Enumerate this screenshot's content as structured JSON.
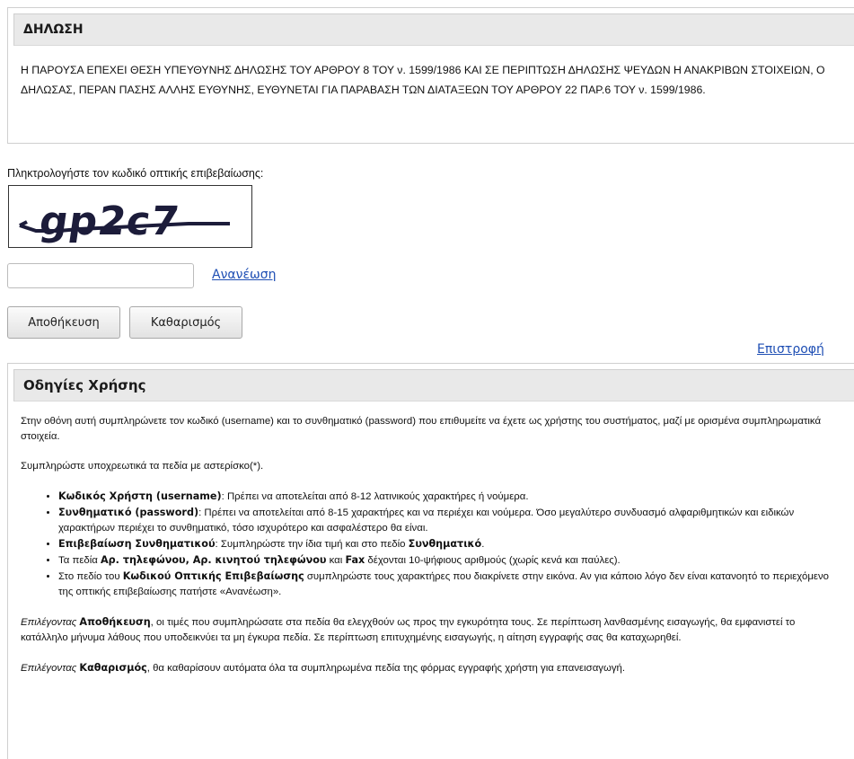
{
  "declaration": {
    "title": "ΔΗΛΩΣΗ",
    "text": "Η ΠΑΡΟΥΣΑ ΕΠΕΧΕΙ ΘΕΣΗ ΥΠΕΥΘΥΝΗΣ ΔΗΛΩΣΗΣ ΤΟΥ ΑΡΘΡΟΥ 8 ΤΟΥ ν. 1599/1986 ΚΑΙ ΣΕ ΠΕΡΙΠΤΩΣΗ ΔΗΛΩΣΗΣ ΨΕΥΔΩΝ Η ΑΝΑΚΡΙΒΩΝ ΣΤΟΙΧΕΙΩΝ, Ο ΔΗΛΩΣΑΣ, ΠΕΡΑΝ ΠΑΣΗΣ ΑΛΛΗΣ ΕΥΘΥΝΗΣ, ΕΥΘΥΝΕΤΑΙ ΓΙΑ ΠΑΡΑΒΑΣΗ ΤΩΝ ΔΙΑΤΑΞΕΩΝ ΤΟΥ ΑΡΘΡΟΥ 22 ΠΑΡ.6 ΤΟΥ ν. 1599/1986."
  },
  "captcha": {
    "label": "Πληκτρολογήστε τον κωδικό οπτικής επιβεβαίωσης:",
    "image_text": "gp2c7",
    "input_value": "",
    "refresh_label": "Ανανέωση"
  },
  "buttons": {
    "save": "Αποθήκευση",
    "clear": "Καθαρισμός"
  },
  "return_link": "Επιστροφή",
  "instructions": {
    "title": "Οδηγίες Χρήσης",
    "intro": "Στην οθόνη αυτή συμπληρώνετε τον κωδικό (username) και το συνθηματικό (password) που επιθυμείτε να έχετε ως χρήστης του συστήματος, μαζί με ορισμένα συμπληρωματικά στοιχεία.",
    "required": "Συμπληρώστε υποχρεωτικά τα πεδία με αστερίσκο(*).",
    "items": [
      {
        "bold": "Κωδικός Χρήστη (username)",
        "text": ": Πρέπει να αποτελείται από 8-12 λατινικούς χαρακτήρες ή νούμερα."
      },
      {
        "bold": "Συνθηματικό (password)",
        "text": ": Πρέπει να αποτελείται από 8-15 χαρακτήρες και να περιέχει και νούμερα. Όσο μεγαλύτερο συνδυασμό αλφαριθμητικών και ειδικών χαρακτήρων περιέχει το συνθηματικό, τόσο ισχυρότερο και ασφαλέστερο θα είναι."
      },
      {
        "bold": "Επιβεβαίωση Συνθηματικού",
        "text": ": Συμπληρώστε την ίδια τιμή και στο πεδίο ",
        "bold2": "Συνθηματικό",
        "text2": "."
      },
      {
        "pre": "Τα πεδία ",
        "bold": "Αρ. τηλεφώνου, Αρ. κινητού τηλεφώνου",
        "mid": " και ",
        "bold2": "Fax",
        "text": " δέχονται 10-ψήφιους αριθμούς (χωρίς κενά και παύλες)."
      },
      {
        "pre": "Στο πεδίο του ",
        "bold": "Κωδικού Οπτικής Επιβεβαίωσης",
        "text": " συμπληρώστε τους χαρακτήρες που διακρίνετε στην εικόνα. Αν για κάποιο λόγο δεν είναι κατανοητό το περιεχόμενο της οπτικής επιβεβαίωσης πατήστε «Ανανέωση»."
      }
    ],
    "save_para": {
      "it": "Επιλέγοντας",
      "bold": "Αποθήκευση",
      "text": ", οι τιμές που συμπληρώσατε στα πεδία θα ελεγχθούν ως προς την εγκυρότητα τους. Σε περίπτωση λανθασμένης εισαγωγής, θα εμφανιστεί το κατάλληλο μήνυμα λάθους που υποδεικνύει τα μη έγκυρα πεδία. Σε περίπτωση επιτυχημένης εισαγωγής, η αίτηση εγγραφής σας θα καταχωρηθεί."
    },
    "clear_para": {
      "it": "Επιλέγοντας",
      "bold": "Καθαρισμός",
      "text": ", θα καθαρίσουν αυτόματα όλα τα συμπληρωμένα πεδία της φόρμας εγγραφής χρήστη για επανεισαγωγή."
    }
  }
}
